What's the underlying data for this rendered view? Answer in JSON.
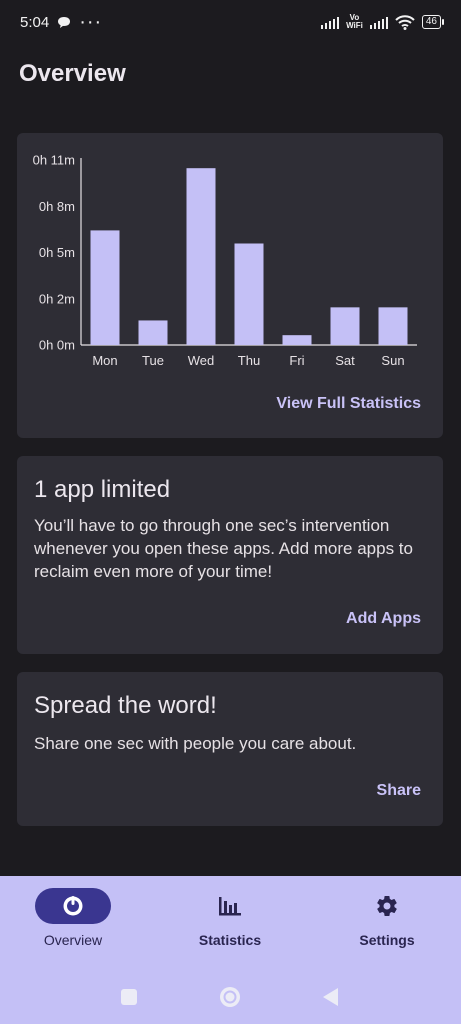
{
  "status_bar": {
    "time": "5:04",
    "dots": "···",
    "vowifi_top": "Vo",
    "vowifi_bottom": "WiFi",
    "battery": "46"
  },
  "page": {
    "title": "Overview"
  },
  "chart_data": {
    "type": "bar",
    "categories": [
      "Mon",
      "Tue",
      "Wed",
      "Thu",
      "Fri",
      "Sat",
      "Sun"
    ],
    "values": [
      7.0,
      1.5,
      10.8,
      6.2,
      0.6,
      2.3,
      2.3
    ],
    "ytick_labels": [
      "0h 0m",
      "0h 2m",
      "0h 5m",
      "0h 8m",
      "0h 11m"
    ],
    "ylim": [
      0,
      11.3
    ],
    "bar_color": "#c4c0f6",
    "grid": false
  },
  "overview_card": {
    "link": "View Full Statistics"
  },
  "limit_card": {
    "title": "1 app limited",
    "body": "You’ll have to go through one sec’s intervention whenever you open these apps. Add more apps to reclaim even more of your time!",
    "link": "Add Apps"
  },
  "share_card": {
    "title": "Spread the word!",
    "body": "Share one sec with people you care about.",
    "link": "Share"
  },
  "bottom_nav": {
    "items": [
      {
        "label": "Overview",
        "icon": "overview-dial-icon",
        "active": true
      },
      {
        "label": "Statistics",
        "icon": "bar-chart-icon",
        "active": false
      },
      {
        "label": "Settings",
        "icon": "gear-icon",
        "active": false
      }
    ]
  },
  "colors": {
    "background": "#1c1b1f",
    "card": "#2e2d35",
    "accent": "#c9c2f7",
    "nav_background": "#c4c0f6",
    "nav_active_pill": "#3a3690"
  }
}
